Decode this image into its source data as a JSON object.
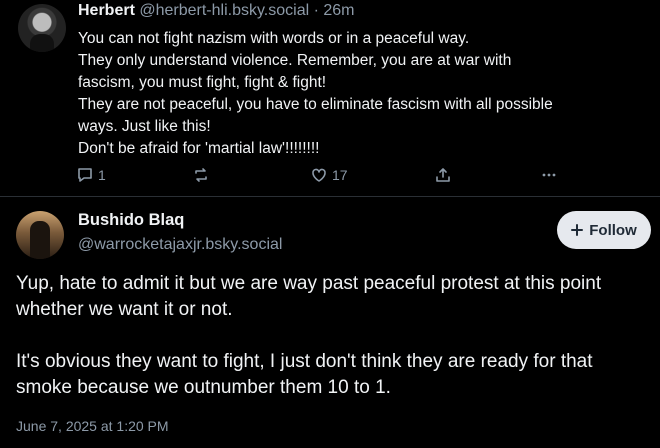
{
  "post1": {
    "author_name": "Herbert",
    "author_handle": "@herbert-hli.bsky.social",
    "separator": "·",
    "age": "26m",
    "lines": [
      "You can not fight nazism with words or in a peaceful way.",
      "They only understand violence. Remember, you are at war with",
      "fascism, you must fight, fight & fight!",
      "They are not peaceful, you have to eliminate fascism with all possible",
      "ways. Just like this!",
      "Don't be afraid for 'martial law'!!!!!!!!"
    ],
    "reply_count": "1",
    "repost_count": "",
    "like_count": "17",
    "icons": [
      "reply-icon",
      "repost-icon",
      "like-icon",
      "share-icon",
      "more-icon"
    ]
  },
  "post2": {
    "author_name": "Bushido Blaq",
    "author_handle": "@warrocketajaxjr.bsky.social",
    "follow_label": "Follow",
    "paragraphs": [
      "Yup, hate to admit it but we are way past peaceful protest at this point whether we want it or not.",
      "It's obvious they want to fight, I just don't think they are ready for that smoke because we outnumber them 10 to 1."
    ],
    "timestamp": "June 7, 2025 at 1:20 PM"
  },
  "colors": {
    "background": "#000000",
    "text": "#f1f3f5",
    "muted": "#8d9aa8",
    "follow_bg": "#e6e9ee"
  }
}
